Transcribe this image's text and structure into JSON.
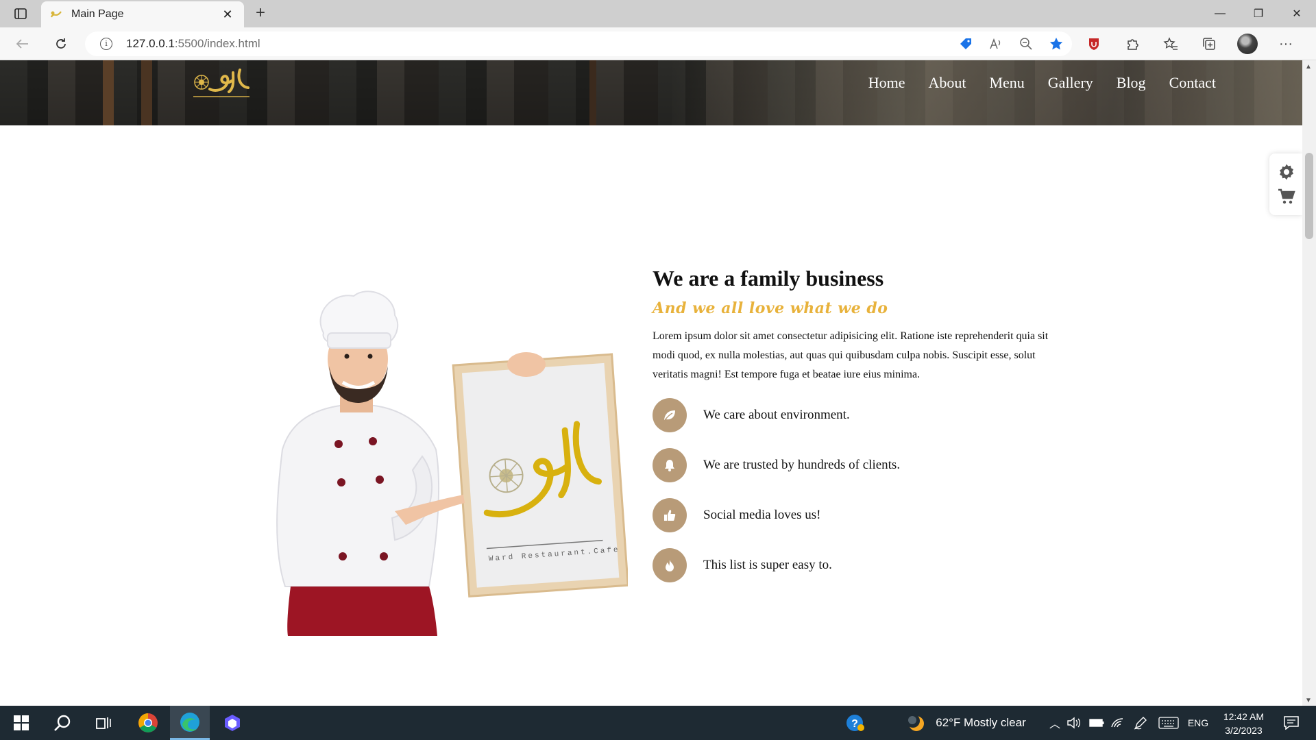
{
  "browser": {
    "tab_title": "Main Page",
    "tab_close": "✕",
    "new_tab": "+",
    "url_host": "127.0.0.1",
    "url_path": ":5500/index.html",
    "window_controls": [
      "—",
      "❐",
      "✕"
    ],
    "more_label": "···"
  },
  "nav": {
    "items": [
      "Home",
      "About",
      "Menu",
      "Gallery",
      "Blog",
      "Contact"
    ]
  },
  "about": {
    "heading": "We are a family business",
    "subheading": "And we all love what we do",
    "paragraph": "Lorem ipsum dolor sit amet consectetur adipisicing elit. Ratione iste reprehenderit quia sit modi quod, ex nulla molestias, aut quas qui quibusdam culpa nobis. Suscipit esse, solut veritatis magni! Est tempore fuga et beatae iure eius minima.",
    "features": [
      {
        "icon": "leaf-icon",
        "text": "We care about environment."
      },
      {
        "icon": "bell-icon",
        "text": "We are trusted by hundreds of clients."
      },
      {
        "icon": "thumbs-up-icon",
        "text": "Social media loves us!"
      },
      {
        "icon": "fire-icon",
        "text": "This list is super easy to."
      }
    ],
    "accent_color": "#e8b23b",
    "icon_bg_color": "#b89b78"
  },
  "taskbar": {
    "weather": "62°F  Mostly clear",
    "language": "ENG",
    "time": "12:42 AM",
    "date": "3/2/2023"
  }
}
